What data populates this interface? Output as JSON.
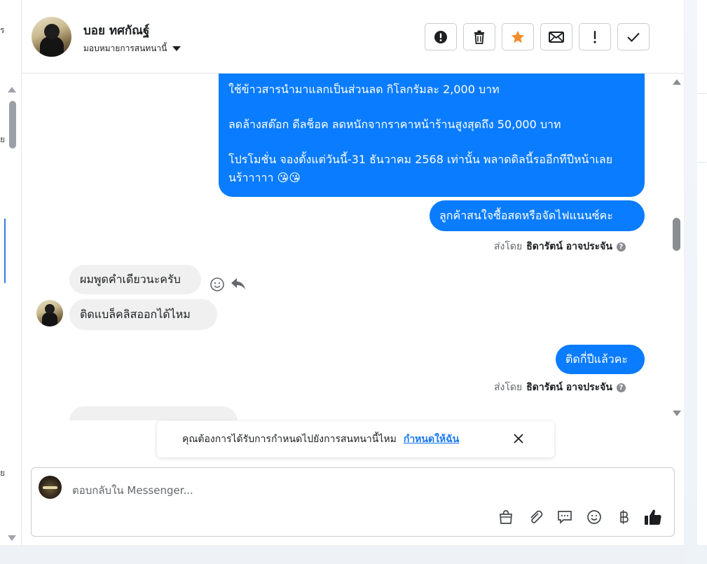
{
  "left_fragments": [
    "ร",
    "ย",
    "ย"
  ],
  "header": {
    "name": "บอย ทศกัณฐ์",
    "assign_label": "มอบหมายการสนทนานี้"
  },
  "toolbar": {
    "icons": [
      "alert-circle-icon",
      "trash-icon",
      "star-icon",
      "mail-icon",
      "exclamation-icon",
      "check-icon"
    ],
    "star_color": "#f28c28"
  },
  "messages": {
    "big_lines": [
      "ใช้ข้าวสารนำมาแลกเป็นส่วนลด กิโลกรัมละ 2,000 บาท",
      "ลดล้างสต๊อก ดีลช็อค ลดหนักจากราคาหน้าร้านสูงสุดถึง 50,000 บาท",
      "โปรโมชั่น  จองตั้งแต่วันนี้-31 ธันวาคม 2568 เท่านั้น พลาดดิลนี้รออีกทีปีหน้าเลยนร้าาาาา 😘😘"
    ],
    "out_2": "ลูกค้าสนใจซื้อสดหรือจัดไฟแนนซ์คะ",
    "sent_by_prefix": "ส่งโดย",
    "sent_by_name": "ธิดารัตน์ อาจประจัน",
    "in_1": "ผมพูดคำเดียวนะครับ",
    "in_2": "ติดแบล็คลิสออกได้ไหม",
    "in_3_partial": "...",
    "out_3": "ติดกี่ปีแล้วคะ"
  },
  "notice": {
    "question": "คุณต้องการได้รับการกำหนดไปยังการสนทนานี้ไหม",
    "link": "กำหนดให้ฉัน"
  },
  "composer": {
    "placeholder": "ตอบกลับใน Messenger..."
  },
  "colors": {
    "outgoing": "#0a7cff",
    "incoming": "#f0f0f0",
    "link": "#1877f2"
  }
}
